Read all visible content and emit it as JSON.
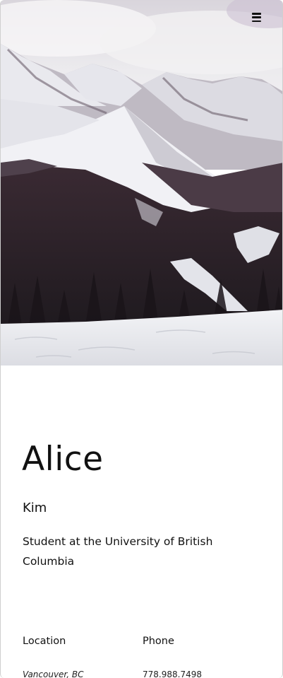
{
  "header": {
    "menu_icon": "hamburger-menu-icon"
  },
  "hero": {
    "image_description_icon": "mountain-landscape-image"
  },
  "profile": {
    "first_name": "Alice",
    "last_name": "Kim",
    "bio": "Student at the University of British Columbia"
  },
  "info": {
    "location_label": "Location",
    "location_value": "Vancouver, BC",
    "phone_label": "Phone",
    "phone_value": "778.988.7498"
  }
}
